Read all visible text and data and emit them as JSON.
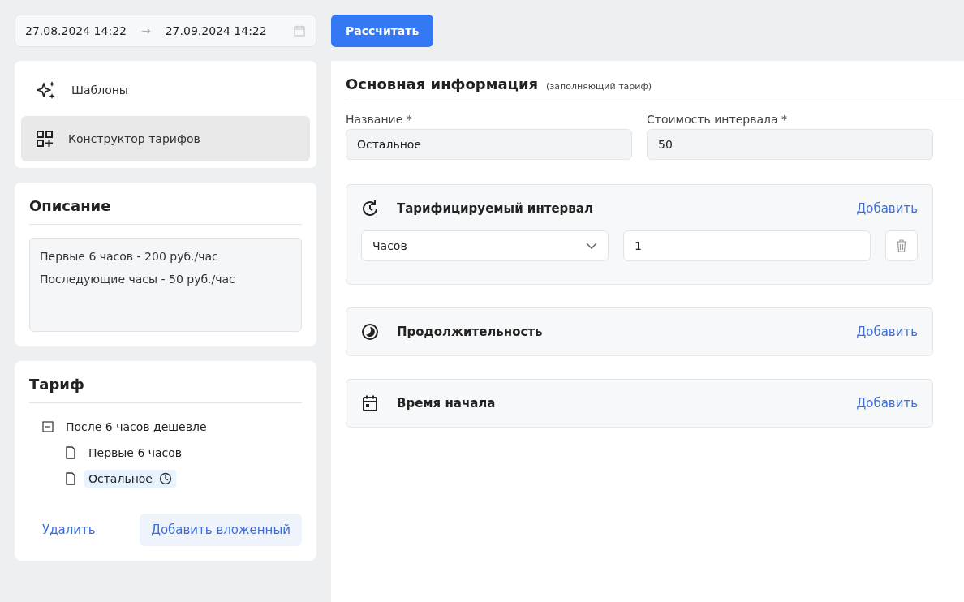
{
  "date_range": {
    "start": "27.08.2024 14:22",
    "separator": "→",
    "end": "27.09.2024 14:22"
  },
  "calculate_button": "Рассчитать",
  "nav": [
    {
      "kind": "templates",
      "label": "Шаблоны",
      "selected": false
    },
    {
      "kind": "constructor",
      "label": "Конструктор тарифов",
      "selected": true
    }
  ],
  "description": {
    "title": "Описание",
    "lines": [
      "Первые 6 часов - 200 руб./час",
      "Последующие часы - 50 руб./час"
    ]
  },
  "tariff": {
    "title": "Тариф",
    "tree": [
      {
        "label": "После 6 часов дешевле",
        "expanded": true,
        "children": [
          {
            "label": "Первые 6 часов",
            "selected": false,
            "timed": false
          },
          {
            "label": "Остальное",
            "selected": true,
            "timed": true
          }
        ]
      }
    ],
    "delete_link": "Удалить",
    "add_child_button": "Добавить вложенный"
  },
  "main": {
    "title": "Основная информация",
    "subtitle": "(заполняющий тариф)",
    "fields": [
      {
        "label": "Название *",
        "value": "Остальное"
      },
      {
        "label": "Стоимость интервала *",
        "value": "50"
      }
    ],
    "sections": [
      {
        "kind": "interval",
        "title": "Тарифицируемый интервал",
        "action": "Добавить",
        "rows": [
          {
            "unit": "Часов",
            "value": "1"
          }
        ]
      },
      {
        "kind": "duration",
        "title": "Продолжительность",
        "action": "Добавить"
      },
      {
        "kind": "start",
        "title": "Время начала",
        "action": "Добавить"
      }
    ]
  }
}
